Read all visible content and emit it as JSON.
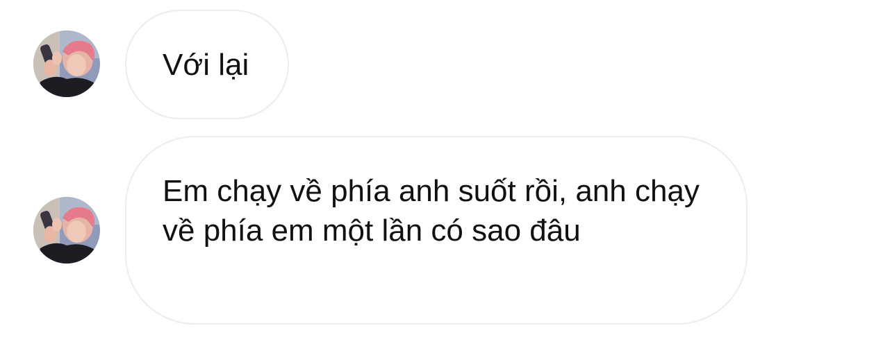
{
  "conversation": {
    "messages": [
      {
        "sender_avatar": "avatar-photo",
        "text": "Với lại"
      },
      {
        "sender_avatar": "avatar-photo",
        "text": "Em chạy về phía anh suốt rồi, anh chạy về phía em một lần có sao đâu"
      }
    ]
  },
  "colors": {
    "background": "#ffffff",
    "bubble_border": "#ececec",
    "text": "#111111"
  }
}
